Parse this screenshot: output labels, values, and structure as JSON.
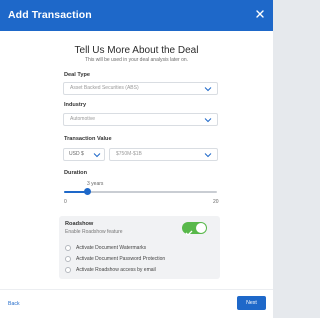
{
  "dialog": {
    "title": "Add Transaction",
    "close_icon": "close-icon"
  },
  "intro": {
    "headline": "Tell Us More About the Deal",
    "subline": "This will be used in your deal analysis later on."
  },
  "deal_type": {
    "label": "Deal Type",
    "value": "Asset Backed Securities (ABS)"
  },
  "industry": {
    "label": "Industry",
    "value": "Automotive"
  },
  "transaction_value": {
    "label": "Transaction Value",
    "currency": "USD $",
    "amount": "$750M-$1B"
  },
  "duration": {
    "label": "Duration",
    "value_text": "3 years",
    "value": 3,
    "min": 0,
    "max": 20,
    "min_label": "0",
    "max_label": "20"
  },
  "roadshow": {
    "title": "Roadshow",
    "subtitle": "Enable Roadshow feature",
    "enabled": true,
    "options": [
      "Activate Document Watermarks",
      "Activate Document Password Protection",
      "Activate Roadshow access by email"
    ]
  },
  "footer": {
    "back_label": "Back",
    "next_label": "Next"
  },
  "colors": {
    "primary": "#1e68c9",
    "toggle_on": "#58b84a"
  }
}
